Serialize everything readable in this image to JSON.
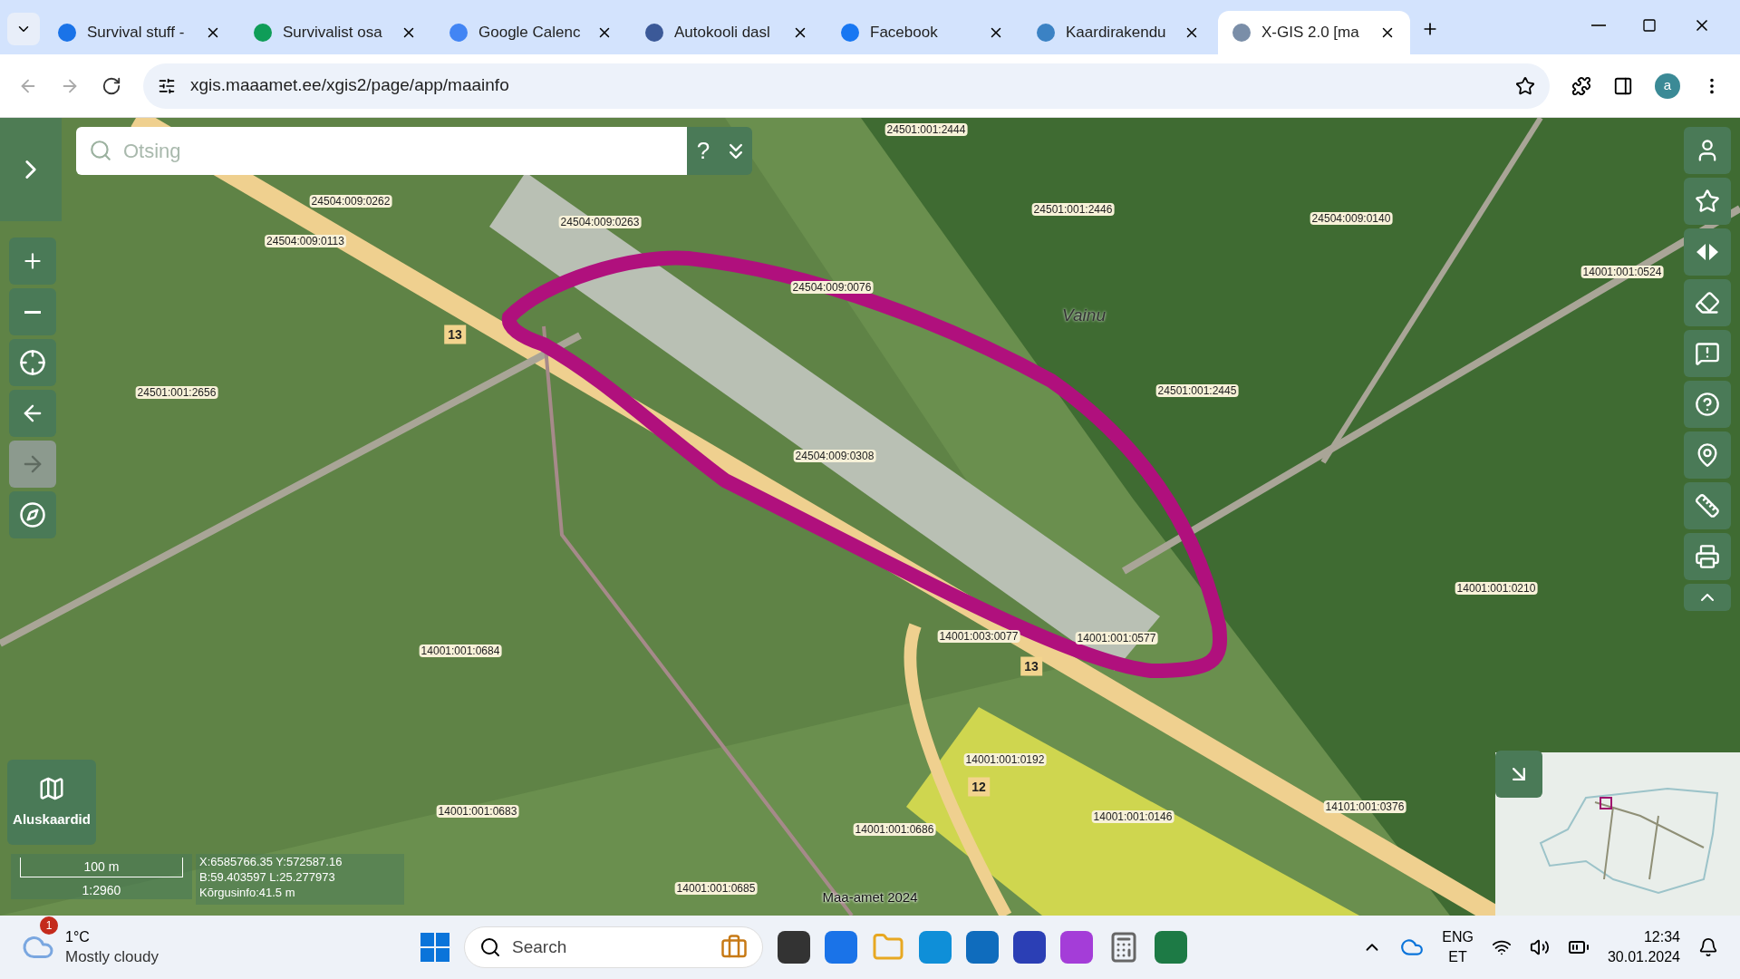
{
  "browser": {
    "tabs": [
      {
        "title": "Survival stuff -",
        "selected": false
      },
      {
        "title": "Survivalist osa",
        "selected": false
      },
      {
        "title": "Google Calenc",
        "selected": false
      },
      {
        "title": "Autokooli dasl",
        "selected": false
      },
      {
        "title": "Facebook",
        "selected": false
      },
      {
        "title": "Kaardirakendu",
        "selected": false
      },
      {
        "title": "X-GIS 2.0 [ma",
        "selected": true
      }
    ],
    "back_disabled": true,
    "forward_disabled": true,
    "url": "xgis.maaamet.ee/xgis2/page/app/maainfo",
    "profile_initial": "a"
  },
  "map": {
    "search": {
      "placeholder": "Otsing"
    },
    "help_label": "?",
    "labels": [
      {
        "text": "24504:009:0262",
        "kind": "parcel"
      },
      {
        "text": "24504:009:0113",
        "kind": "parcel"
      },
      {
        "text": "24504:009:0263",
        "kind": "parcel"
      },
      {
        "text": "24501:001:2444",
        "kind": "parcel"
      },
      {
        "text": "24501:001:2446",
        "kind": "parcel"
      },
      {
        "text": "24504:009:0140",
        "kind": "parcel"
      },
      {
        "text": "14001:001:0524",
        "kind": "parcel"
      },
      {
        "text": "24504:009:0076",
        "kind": "parcel"
      },
      {
        "text": "Vainu",
        "kind": "place"
      },
      {
        "text": "13",
        "kind": "road"
      },
      {
        "text": "24501:001:2656",
        "kind": "parcel"
      },
      {
        "text": "24501:001:2445",
        "kind": "parcel"
      },
      {
        "text": "24504:009:0308",
        "kind": "parcel"
      },
      {
        "text": "14001:001:0210",
        "kind": "parcel"
      },
      {
        "text": "14001:003:0077",
        "kind": "parcel"
      },
      {
        "text": "14001:001:0577",
        "kind": "parcel"
      },
      {
        "text": "14001:001:0684",
        "kind": "parcel"
      },
      {
        "text": "13",
        "kind": "road"
      },
      {
        "text": "14001:001:0192",
        "kind": "parcel"
      },
      {
        "text": "12",
        "kind": "road"
      },
      {
        "text": "14001:001:0683",
        "kind": "parcel"
      },
      {
        "text": "14001:001:0686",
        "kind": "parcel"
      },
      {
        "text": "14001:001:0146",
        "kind": "parcel"
      },
      {
        "text": "14101:001:0376",
        "kind": "parcel"
      },
      {
        "text": "14001:001:0685",
        "kind": "parcel"
      },
      {
        "text": "Maa-amet 2024",
        "kind": "attribution"
      }
    ],
    "forward_disabled": true,
    "basemaps_label": "Aluskaardid",
    "scale": {
      "distance": "100 m",
      "ratio": "1:2960"
    },
    "coordinates": [
      "X:6585766.35 Y:572587.16",
      "B:59.403597 L:25.277973",
      "Kõrgusinfo:41.5 m"
    ]
  },
  "taskbar": {
    "weather": {
      "badge": "1",
      "temperature": "1°C",
      "condition": "Mostly cloudy"
    },
    "search_placeholder": "Search",
    "language": [
      "ENG",
      "ET"
    ],
    "time": "12:34",
    "date": "30.01.2024"
  }
}
